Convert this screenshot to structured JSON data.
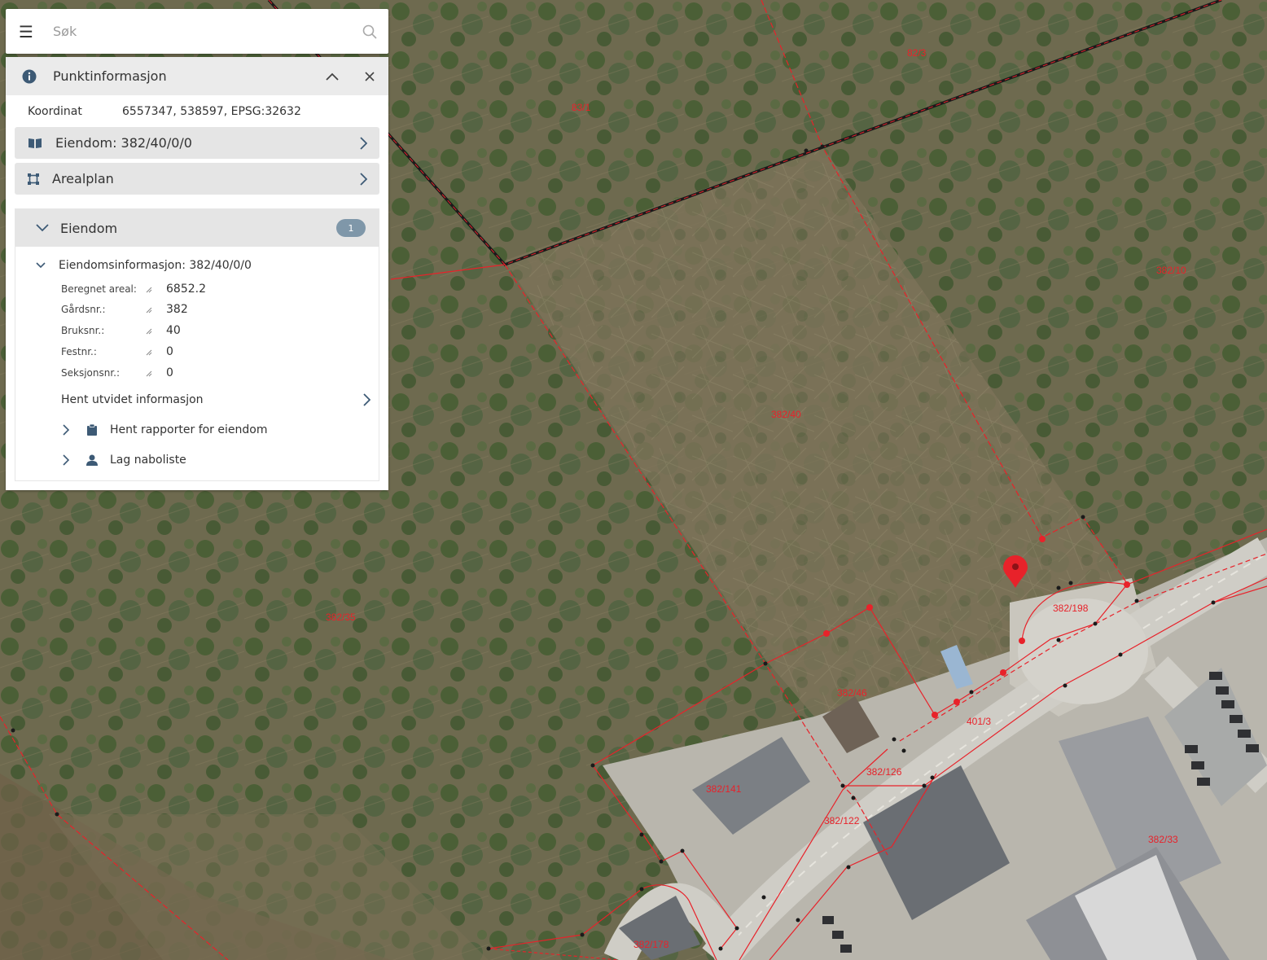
{
  "search": {
    "placeholder": "Søk"
  },
  "panel": {
    "title": "Punktinformasjon",
    "coordinate_label": "Koordinat",
    "coordinate_value": "6557347, 538597, EPSG:32632",
    "nav_rows": [
      {
        "label": "Eiendom: 382/40/0/0",
        "icon": "book-icon"
      },
      {
        "label": "Arealplan",
        "icon": "area-plan-icon"
      }
    ],
    "eiendom": {
      "title": "Eiendom",
      "count": "1",
      "info_title": "Eiendomsinformasjon: 382/40/0/0",
      "attributes": [
        {
          "label": "Beregnet areal:",
          "value": "6852.2"
        },
        {
          "label": "Gårdsnr.:",
          "value": "382"
        },
        {
          "label": "Bruksnr.:",
          "value": "40"
        },
        {
          "label": "Festnr.:",
          "value": "0"
        },
        {
          "label": "Seksjonsnr.:",
          "value": "0"
        }
      ],
      "extended_info": "Hent utvidet informasjon",
      "actions": [
        {
          "label": "Hent rapporter for eiendom",
          "icon": "clipboard-icon"
        },
        {
          "label": "Lag naboliste",
          "icon": "person-icon"
        }
      ]
    }
  },
  "map": {
    "parcel_labels": [
      "82/3",
      "83/1",
      "382/10",
      "382/40",
      "382/35",
      "382/198",
      "382/46",
      "401/3",
      "382/126",
      "382/141",
      "382/122",
      "382/33",
      "382/178"
    ],
    "boundary_color": "#e8222a",
    "marker_color": "#e8222a"
  }
}
